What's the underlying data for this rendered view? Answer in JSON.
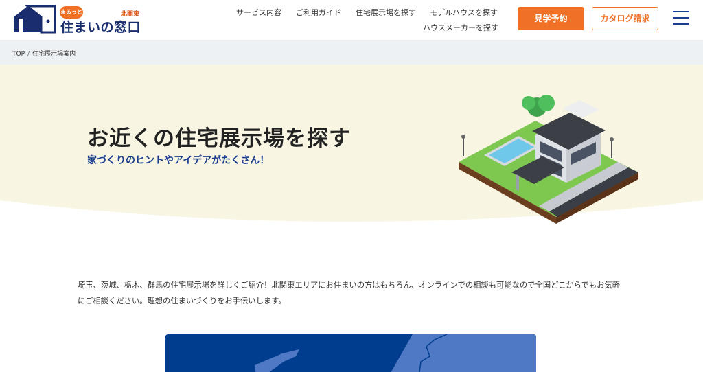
{
  "header": {
    "logo": {
      "badge": "まるっと",
      "region": "北関東",
      "name": "住まいの窓口"
    },
    "nav": [
      {
        "label": "サービス内容"
      },
      {
        "label": "ご利用ガイド"
      },
      {
        "label": "住宅展示場を探す"
      },
      {
        "label": "モデルハウスを探す"
      },
      {
        "label": "ハウスメーカーを探す"
      }
    ],
    "visit_button": "見学予約",
    "catalog_button": "カタログ請求",
    "menu_icon": "hamburger-menu-icon"
  },
  "breadcrumb": {
    "items": [
      "TOP",
      "住宅展示場案内"
    ],
    "separator": "/"
  },
  "hero": {
    "title": "お近くの住宅展示場を探す",
    "subtitle": "家づくりのヒントやアイデアがたくさん！",
    "background_color": "#f8f6e3"
  },
  "intro": {
    "line1": "埼玉、茨城、栃木、群馬の住宅展示場を詳しくご紹介！北関東エリアにお住まいの方はもちろん、オンラインでの相談も可能なので全国どこからでもお気軽",
    "line2": "にご相談ください。理想の住まいづくりをお手伝いします。"
  },
  "colors": {
    "accent_orange": "#f07125",
    "brand_navy": "#1a3d8f",
    "map_blue": "#003d8f"
  }
}
